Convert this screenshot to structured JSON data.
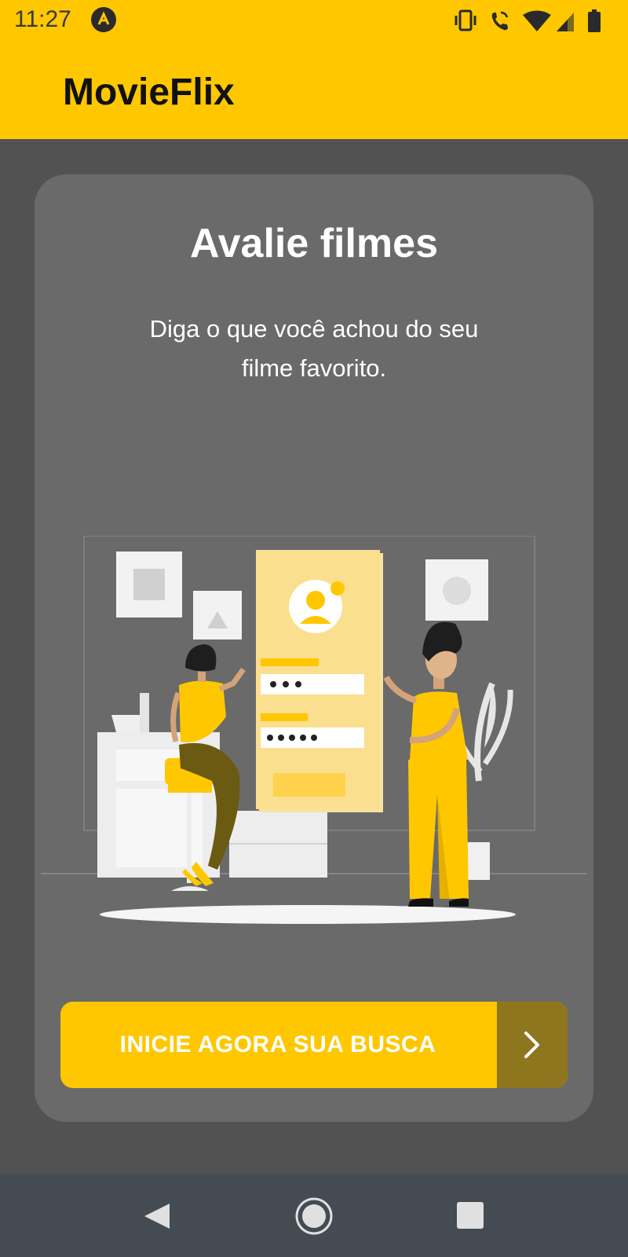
{
  "status_bar": {
    "time": "11:27",
    "icons": [
      "app-notification-icon",
      "vibrate-icon",
      "wifi-calling-icon",
      "wifi-icon",
      "signal-icon",
      "battery-icon"
    ]
  },
  "app_bar": {
    "title": "MovieFlix"
  },
  "card": {
    "title": "Avalie filmes",
    "subtitle_line1": "Diga o que você achou do seu",
    "subtitle_line2": "filme favorito."
  },
  "cta": {
    "label": "INICIE AGORA SUA BUSCA",
    "icon": "chevron-right-icon"
  },
  "nav": {
    "icons": [
      "back-icon",
      "home-icon",
      "recents-icon"
    ]
  },
  "colors": {
    "accent": "#FFC700",
    "background": "#525252",
    "card": "#6A6A6A",
    "cta_arrow_box": "#8E761E",
    "nav_bar": "#454B52"
  }
}
